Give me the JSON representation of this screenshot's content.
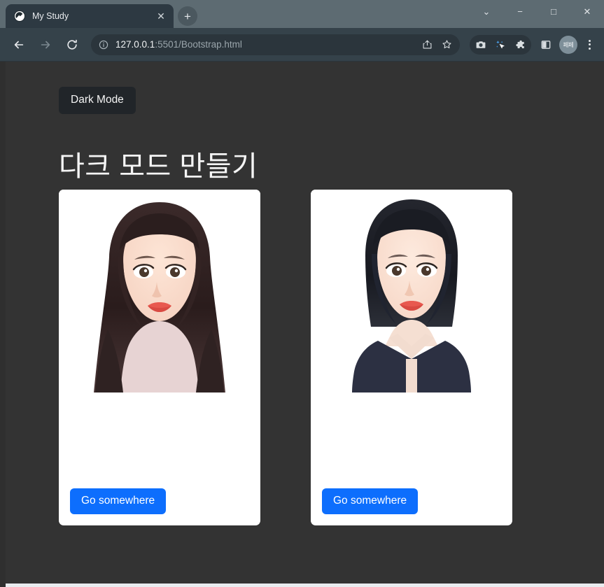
{
  "browser": {
    "tab": {
      "title": "My Study",
      "favicon": "globe-s-icon",
      "close_label": "✕"
    },
    "new_tab_label": "+",
    "window_controls": [
      {
        "name": "tab-search-button",
        "glyph": "⌄"
      },
      {
        "name": "minimize-button",
        "glyph": "−"
      },
      {
        "name": "maximize-button",
        "glyph": "□"
      },
      {
        "name": "close-button",
        "glyph": "✕"
      }
    ],
    "nav": {
      "back_label": "←",
      "forward_label": "→",
      "reload_label": "↻"
    },
    "omnibox": {
      "host": "127.0.0.1",
      "path": ":5501/Bootstrap.html",
      "full_url": "127.0.0.1:5501/Bootstrap.html",
      "site_info_icon": "info-circle-icon",
      "share_icon": "share-icon",
      "bookmark_icon": "star-icon"
    },
    "extensions": [
      {
        "name": "screenshot-extension-icon",
        "glyph": "camera-icon"
      },
      {
        "name": "cursor-extension-icon",
        "glyph": "sparkle-cursor-icon"
      },
      {
        "name": "extensions-puzzle-icon",
        "glyph": "puzzle-icon"
      }
    ],
    "side_panel_icon": "side-panel-icon",
    "profile": {
      "name": "profile-avatar",
      "initials": "페페"
    },
    "menu_icon": "three-dot-menu-icon"
  },
  "page": {
    "theme_toggle_label": "Dark Mode",
    "heading": "다크 모드 만들기",
    "cards": [
      {
        "image_alt": "portrait-long-hair",
        "button_label": "Go somewhere"
      },
      {
        "image_alt": "portrait-bob-hair",
        "button_label": "Go somewhere"
      }
    ],
    "colors": {
      "background": "#333333",
      "card_background": "#ffffff",
      "primary_button": "#0d6efd",
      "toggle_button": "#212529",
      "text": "#f5f5f5"
    }
  }
}
